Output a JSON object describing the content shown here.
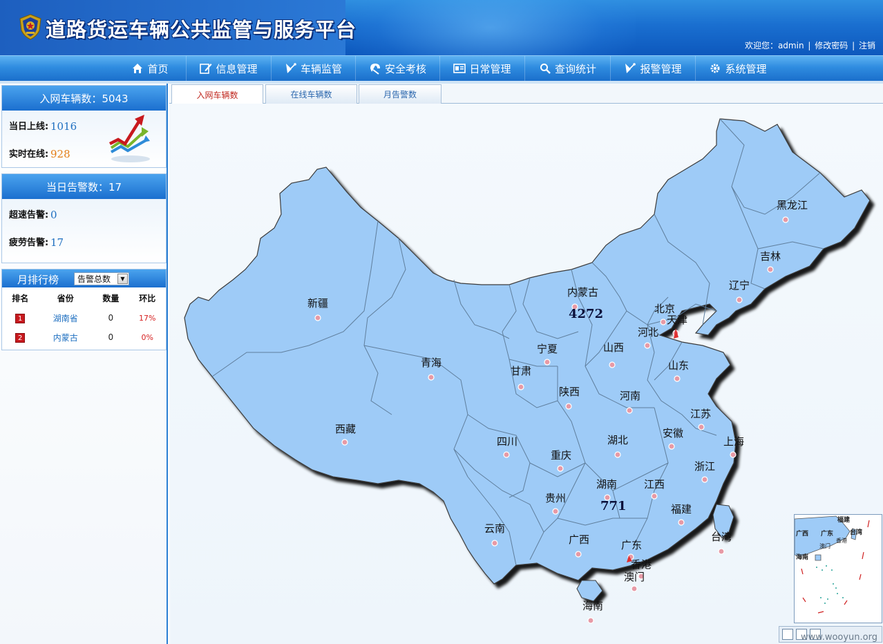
{
  "header": {
    "title": "道路货运车辆公共监管与服务平台",
    "welcome": "欢迎您：admin",
    "sep1": "|",
    "change_password": "修改密码",
    "sep2": "|",
    "logout": "注销"
  },
  "nav": [
    {
      "label": "首页",
      "icon": "home-icon"
    },
    {
      "label": "信息管理",
      "icon": "edit-icon"
    },
    {
      "label": "车辆监管",
      "icon": "satellite-icon"
    },
    {
      "label": "安全考核",
      "icon": "shield-icon"
    },
    {
      "label": "日常管理",
      "icon": "id-card-icon"
    },
    {
      "label": "查询统计",
      "icon": "search-icon"
    },
    {
      "label": "报警管理",
      "icon": "alarm-icon"
    },
    {
      "label": "系统管理",
      "icon": "gear-icon"
    }
  ],
  "sidebar": {
    "vehicles_title": "入网车辆数：5043",
    "online_today_label": "当日上线:",
    "online_today_value": "1016",
    "realtime_online_label": "实时在线:",
    "realtime_online_value": "928",
    "alarms_title": "当日告警数：17",
    "speeding_label": "超速告警:",
    "speeding_value": "0",
    "fatigue_label": "疲劳告警:",
    "fatigue_value": "17",
    "ranking_title": "月排行榜",
    "ranking_select": "告警总数",
    "ranking_headers": [
      "排名",
      "省份",
      "数量",
      "环比"
    ],
    "ranking_rows": [
      {
        "rank": "1",
        "province": "湖南省",
        "count": "0",
        "ratio": "17%"
      },
      {
        "rank": "2",
        "province": "内蒙古",
        "count": "0",
        "ratio": "0%"
      }
    ]
  },
  "tabs": [
    {
      "label": "入网车辆数",
      "active": true
    },
    {
      "label": "在线车辆数",
      "active": false
    },
    {
      "label": "月告警数",
      "active": false
    }
  ],
  "map": {
    "provinces": [
      {
        "name": "黑龙江"
      },
      {
        "name": "吉林"
      },
      {
        "name": "辽宁"
      },
      {
        "name": "内蒙古",
        "count": "4272"
      },
      {
        "name": "北京"
      },
      {
        "name": "天津"
      },
      {
        "name": "河北"
      },
      {
        "name": "山西"
      },
      {
        "name": "山东"
      },
      {
        "name": "新疆"
      },
      {
        "name": "宁夏"
      },
      {
        "name": "青海"
      },
      {
        "name": "甘肃"
      },
      {
        "name": "陕西"
      },
      {
        "name": "河南"
      },
      {
        "name": "江苏"
      },
      {
        "name": "西藏"
      },
      {
        "name": "四川"
      },
      {
        "name": "湖北"
      },
      {
        "name": "安徽"
      },
      {
        "name": "上海"
      },
      {
        "name": "重庆"
      },
      {
        "name": "浙江"
      },
      {
        "name": "湖南",
        "count": "771"
      },
      {
        "name": "江西"
      },
      {
        "name": "贵州"
      },
      {
        "name": "福建"
      },
      {
        "name": "云南"
      },
      {
        "name": "广西"
      },
      {
        "name": "广东"
      },
      {
        "name": "台湾"
      },
      {
        "name": "香港"
      },
      {
        "name": "澳门"
      },
      {
        "name": "海南"
      }
    ],
    "inset_labels": [
      "福建",
      "广西",
      "广东",
      "台湾",
      "香港",
      "澳门",
      "海南"
    ],
    "fill_color": "#9ecbf7",
    "border_color": "#5f7e9c"
  },
  "watermark": "www.wooyun.org"
}
